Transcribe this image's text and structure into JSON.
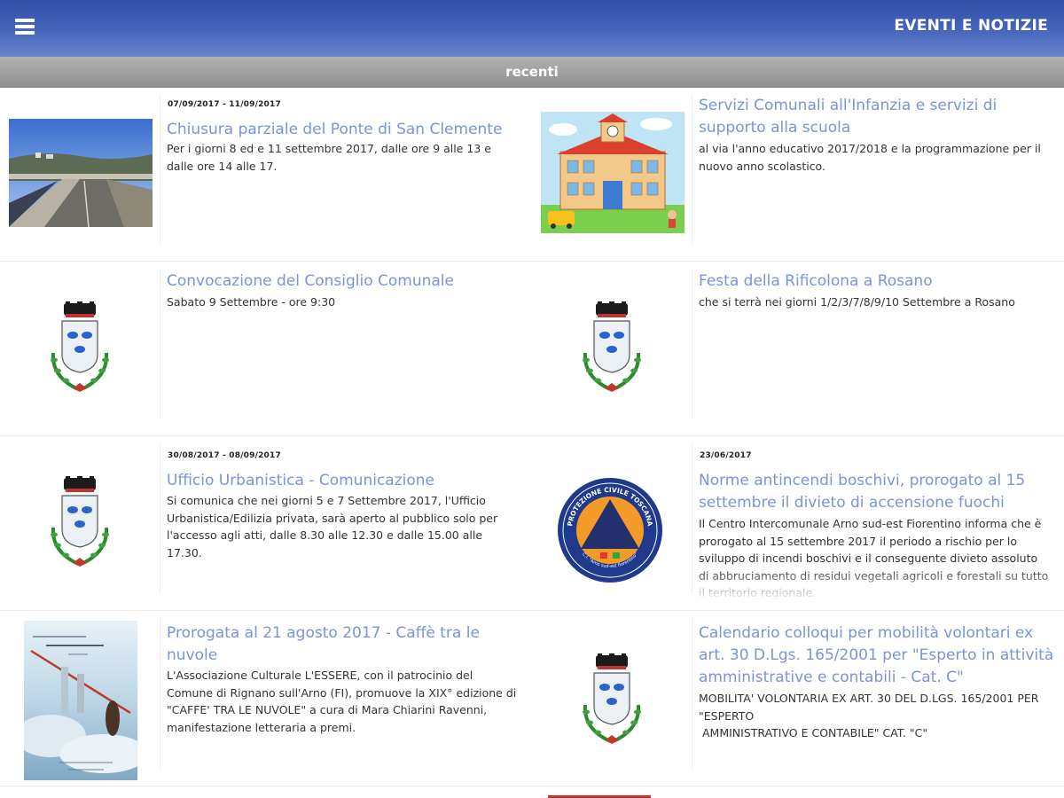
{
  "header": {
    "title": "EVENTI E NOTIZIE",
    "menu_icon": "hamburger-menu-icon"
  },
  "subheader": {
    "label": "recenti"
  },
  "items": [
    {
      "date": "07/09/2017 - 11/09/2017",
      "title": "Chiusura parziale del Ponte di San Clemente",
      "description": "Per i giorni 8 ed e 11 settembre 2017, dalle ore 9 alle 13 e dalle ore 14 alle 17.",
      "thumb": "bridge-photo"
    },
    {
      "date": "",
      "title": "Servizi Comunali all'Infanzia e servizi di supporto alla scuola",
      "description": "al via l'anno educativo 2017/2018 e la programmazione per il nuovo anno scolastico.",
      "thumb": "school-illustration"
    },
    {
      "date": "",
      "title": "Convocazione del Consiglio Comunale",
      "description": "Sabato 9 Settembre - ore 9:30",
      "thumb": "municipal-crest"
    },
    {
      "date": "",
      "title": "Festa della Rificolona a Rosano",
      "description": "che si terrà nei giorni 1/2/3/7/8/9/10 Settembre a Rosano",
      "thumb": "municipal-crest"
    },
    {
      "date": "30/08/2017 - 08/09/2017",
      "title": "Ufficio Urbanistica - Comunicazione",
      "description": "Si comunica che nei giorni 5 e 7 Settembre 2017, l'Ufficio Urbanistica/Edilizia privata, sarà aperto al pubblico solo per l'accesso agli atti, dalle 8.30 alle 12.30 e dalle 15.00 alle 17.30.",
      "thumb": "municipal-crest"
    },
    {
      "date": "23/06/2017",
      "title": "Norme antincendi boschivi, prorogato al 15 settembre il divieto di accensione fuochi",
      "description": "Il Centro Intercomunale Arno sud-est Fiorentino informa che è prorogato al 15 settembre 2017 il periodo a rischio per lo sviluppo di incendi boschivi e il conseguente divieto assoluto di abbruciamento di residui vegetali agricoli e forestali su tutto il territorio regionale.",
      "thumb": "protezione-civile-logo"
    },
    {
      "date": "",
      "title": "Prorogata al 21 agosto 2017 - Caffè tra le nuvole",
      "description": "L'Associazione Culturale L'ESSERE, con il patrocinio del Comune di Rignano sull'Arno (FI), promuove la XIX° edizione di \"CAFFE' TRA LE NUVOLE\" a cura di Mara Chiarini Ravenni, manifestazione letteraria a premi.",
      "thumb": "event-poster"
    },
    {
      "date": "",
      "title": "Calendario colloqui per mobilità volontari ex art. 30 D.Lgs. 165/2001 per \"Esperto in attività amministrative e contabili - Cat. C\"",
      "description": "MOBILITA' VOLONTARIA EX ART. 30 DEL D.LGS. 165/2001 PER \"ESPERTO\n AMMINISTRATIVO E CONTABILE\" CAT. \"C\"",
      "thumb": "municipal-crest"
    }
  ],
  "protezione_civile_logo": {
    "top_text": "PROTEZIONE CIVILE TOSCANA",
    "bottom_text": "C.I. \"Arno sud-est fiorentino\""
  },
  "colors": {
    "header": "#3f5eb4",
    "subheader": "#a3a3a3",
    "title": "#7b93d8"
  }
}
